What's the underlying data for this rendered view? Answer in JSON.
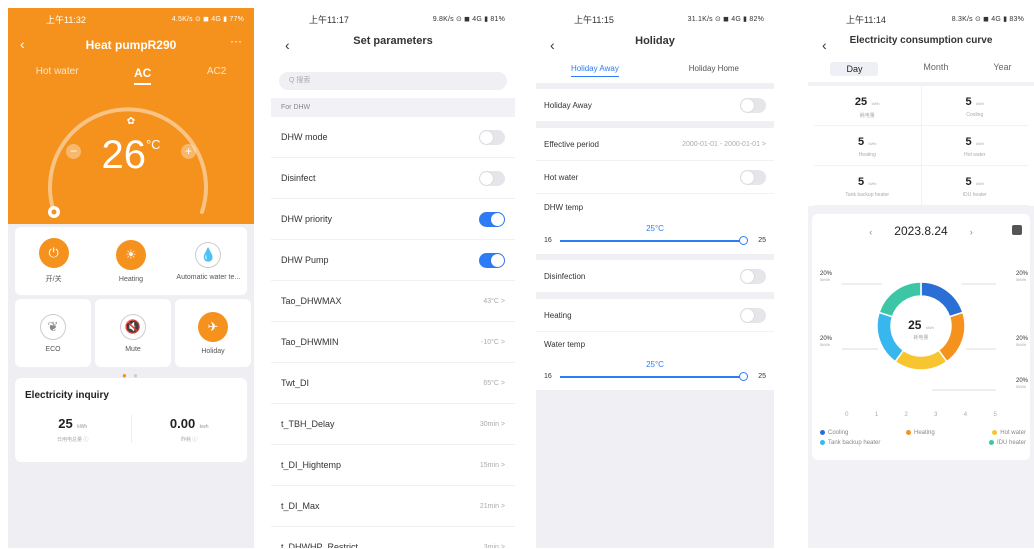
{
  "p1": {
    "status": {
      "time": "上午11:32",
      "right": "4.5K/s ⊙ ◼ 4G ▮ 77%"
    },
    "title": "Heat pumpR290",
    "tabs": [
      "Hot water",
      "AC",
      "AC2"
    ],
    "temp": "26",
    "unit": "°C",
    "functions": [
      {
        "label": "开/关",
        "icon": "power-icon"
      },
      {
        "label": "Heating",
        "icon": "sun-icon"
      },
      {
        "label": "Automatic water te...",
        "icon": "water-drop-icon"
      },
      {
        "label": "ECO",
        "icon": "leaf-icon"
      },
      {
        "label": "Mute",
        "icon": "mute-icon"
      },
      {
        "label": "Holiday",
        "icon": "holiday-icon"
      }
    ],
    "elec_title": "Electricity inquiry",
    "elec": [
      {
        "value": "25",
        "unit": "kWh",
        "label": "日用电总量 ⓘ"
      },
      {
        "value": "0.00",
        "unit": "kwh",
        "label": "昨耗 ⓘ"
      }
    ],
    "colors": {
      "accent": "#f5921e"
    }
  },
  "p2": {
    "status": {
      "time": "上午11:17",
      "right": "9.8K/s ⊙ ◼ 4G ▮ 81%"
    },
    "title": "Set parameters",
    "search_placeholder": "Q 搜索",
    "section": "For DHW",
    "rows": [
      {
        "label": "DHW mode",
        "type": "toggle",
        "on": false
      },
      {
        "label": "Disinfect",
        "type": "toggle",
        "on": false
      },
      {
        "label": "DHW priority",
        "type": "toggle",
        "on": true
      },
      {
        "label": "DHW Pump",
        "type": "toggle",
        "on": true
      },
      {
        "label": "Tao_DHWMAX",
        "value": "43°C >"
      },
      {
        "label": "Tao_DHWMIN",
        "value": "-10°C >"
      },
      {
        "label": "Twt_DI",
        "value": "65°C >"
      },
      {
        "label": "t_TBH_Delay",
        "value": "30min >"
      },
      {
        "label": "t_DI_Hightemp",
        "value": "15min >"
      },
      {
        "label": "t_DI_Max",
        "value": "21min >"
      },
      {
        "label": "t_DHWHP_Restrict",
        "value": "3min >"
      }
    ]
  },
  "p3": {
    "status": {
      "time": "上午11:15",
      "right": "31.1K/s ⊙ ◼ 4G ▮ 82%"
    },
    "title": "Holiday",
    "tabs": [
      "Holiday Away",
      "Holiday Home"
    ],
    "holiday_away": "Holiday Away",
    "effective_label": "Effective period",
    "effective_value": "2000-01-01 - 2000-01-01 >",
    "hot_water": "Hot water",
    "dhw_temp": "DHW temp",
    "dhw_val": "25°C",
    "dhw_min": "16",
    "dhw_max": "25",
    "disinfection": "Disinfection",
    "heating": "Heating",
    "water_temp": "Water temp",
    "water_val": "25°C",
    "water_min": "16",
    "water_max": "25"
  },
  "p4": {
    "status": {
      "time": "上午11:14",
      "right": "8.3K/s ⊙ ◼ 4G ▮ 83%"
    },
    "title": "Electricity consumption curve",
    "tabs": [
      "Day",
      "Month",
      "Year"
    ],
    "stats": [
      {
        "value": "25",
        "unit": "kWh",
        "label": "耗电量"
      },
      {
        "value": "5",
        "unit": "kWh",
        "label": "Cooling"
      },
      {
        "value": "5",
        "unit": "kWh",
        "label": "Heating"
      },
      {
        "value": "5",
        "unit": "kWh",
        "label": "Hot water"
      },
      {
        "value": "5",
        "unit": "kWh",
        "label": "Tank backup heater"
      },
      {
        "value": "5",
        "unit": "kWh",
        "label": "IDU heater"
      }
    ],
    "date": "2023.8.24",
    "center_value": "25",
    "center_unit": "kWh",
    "center_label": "耗电量",
    "pct_label": "20%",
    "pct_sub": "5kWh",
    "axis": [
      "0",
      "1",
      "2",
      "3",
      "4",
      "5"
    ]
  },
  "chart_data": {
    "type": "pie",
    "categories": [
      "Cooling",
      "Heating",
      "Hot water",
      "Tank backup heater",
      "IDU heater"
    ],
    "values": [
      5,
      5,
      5,
      5,
      5
    ],
    "colors": [
      "#2a6fd6",
      "#f5921e",
      "#f7c530",
      "#38b6ee",
      "#3cc6a6"
    ]
  }
}
